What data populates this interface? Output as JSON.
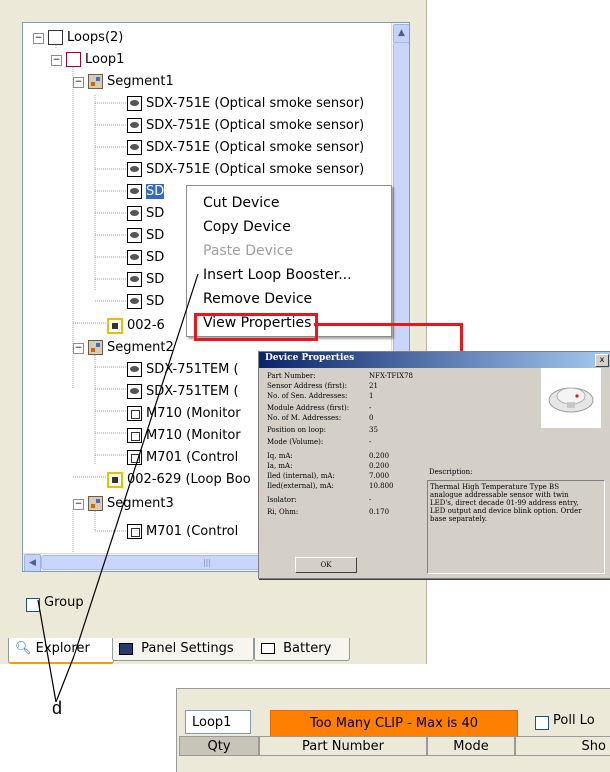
{
  "tree": {
    "nodes": [
      {
        "label": "Loops(2)"
      },
      {
        "label": "Loop1"
      },
      {
        "label": "Segment1"
      },
      {
        "label": "SDX-751E (Optical smoke sensor)"
      },
      {
        "label": "SDX-751E (Optical smoke sensor)"
      },
      {
        "label": "SDX-751E (Optical smoke sensor)"
      },
      {
        "label": "SDX-751E (Optical smoke sensor)"
      },
      {
        "label": "SD"
      },
      {
        "label": "SD"
      },
      {
        "label": "SD"
      },
      {
        "label": "SD"
      },
      {
        "label": "SD"
      },
      {
        "label": "SD"
      },
      {
        "label": "002-6"
      },
      {
        "label": "Segment2"
      },
      {
        "label": "SDX-751TEM ("
      },
      {
        "label": "SDX-751TEM ("
      },
      {
        "label": "M710 (Monitor"
      },
      {
        "label": "M710 (Monitor"
      },
      {
        "label": "M701 (Control"
      },
      {
        "label": "002-629 (Loop Boo"
      },
      {
        "label": "Segment3"
      },
      {
        "label": "M701 (Control"
      }
    ],
    "scroll_mid": "|||"
  },
  "context_menu": {
    "items": [
      {
        "label": "Cut Device",
        "enabled": true
      },
      {
        "label": "Copy Device",
        "enabled": true
      },
      {
        "label": "Paste Device",
        "enabled": false
      },
      {
        "label": "Insert Loop Booster...",
        "enabled": true
      },
      {
        "label": "Remove Device",
        "enabled": true
      },
      {
        "label": "View Properties",
        "enabled": true
      }
    ]
  },
  "group_checkbox": {
    "label": "Group",
    "checked": false
  },
  "tabs": [
    {
      "label": "Explorer",
      "active": true
    },
    {
      "label": "Panel Settings",
      "active": false
    },
    {
      "label": "Battery",
      "active": false
    }
  ],
  "dialog": {
    "title": "Device Properties",
    "close": "x",
    "fields": [
      {
        "label": "Part Number:",
        "value": "NFX-TFIX78"
      },
      {
        "label": "Sensor Address (first):",
        "value": "21"
      },
      {
        "label": "No. of Sen. Addresses:",
        "value": "1"
      },
      {
        "label": "Module Address (first):",
        "value": "-"
      },
      {
        "label": "No. of M. Addresses:",
        "value": "0"
      },
      {
        "label": "Position on loop:",
        "value": "35"
      },
      {
        "label": "Mode (Volume):",
        "value": "-"
      },
      {
        "label": "Iq, mA:",
        "value": "0.200"
      },
      {
        "label": "Ia, mA:",
        "value": "0.200"
      },
      {
        "label": "Iled (internal), mA:",
        "value": "7.000"
      },
      {
        "label": "Iled(external), mA:",
        "value": "10.800"
      },
      {
        "label": "Isolator:",
        "value": "-"
      },
      {
        "label": "Ri, Ohm:",
        "value": "0.170"
      }
    ],
    "description_label": "Description:",
    "description_lines": [
      "Thermal High Temperature Type BS",
      "analogue addressable sensor with twin",
      "LED's, direct decade 01-99 address entry,",
      "LED output and device blink option. Order",
      "base separately."
    ],
    "ok_label": "OK"
  },
  "callout": {
    "label": "d",
    "color": "#e8171c"
  },
  "bottom_bar": {
    "loop_field": "Loop1",
    "warning": "Too Many CLIP - Max is 40",
    "warning_color": "#ff8000",
    "poll_label": "Poll Lo",
    "columns": [
      "Qty",
      "Part Number",
      "Mode",
      "Sho"
    ]
  }
}
